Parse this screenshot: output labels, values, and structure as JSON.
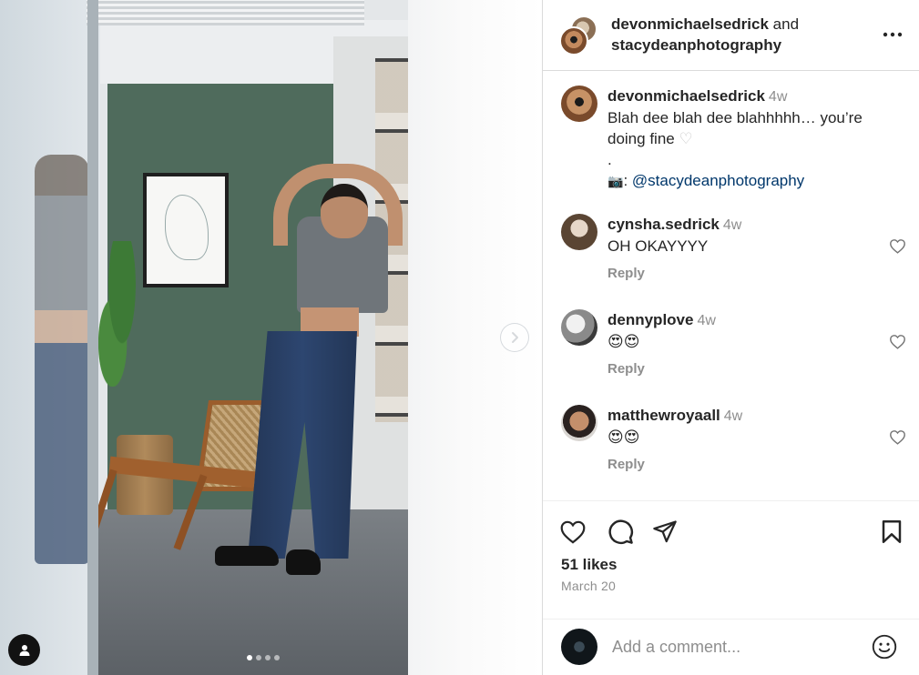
{
  "header": {
    "user1": "devonmichaelsedrick",
    "conjunction": "and",
    "user2": "stacydeanphotography"
  },
  "caption": {
    "username": "devonmichaelsedrick",
    "time": "4w",
    "text": "Blah dee blah dee blahhhhh… you’re doing fine",
    "heart": "♡",
    "dot": ".",
    "camera_emoji": "📷",
    "credit_sep": ":",
    "mention": "@stacydeanphotography"
  },
  "comments": [
    {
      "username": "cynsha.sedrick",
      "time": "4w",
      "text": "OH OKAYYYY",
      "reply": "Reply"
    },
    {
      "username": "dennyplove",
      "time": "4w",
      "text": "😍😍",
      "reply": "Reply"
    },
    {
      "username": "matthewroyaall",
      "time": "4w",
      "text": "😍😍",
      "reply": "Reply"
    }
  ],
  "engagement": {
    "likes": "51 likes",
    "date": "March 20"
  },
  "add_comment": {
    "placeholder": "Add a comment..."
  },
  "carousel": {
    "count": 4,
    "active": 0
  },
  "icons": {
    "more": "more-horizontal-icon",
    "next": "chevron-right-icon",
    "tag": "user-tag-icon",
    "like": "heart-icon",
    "comment": "comment-bubble-icon",
    "share": "paper-plane-icon",
    "save": "bookmark-icon",
    "emoji": "smiley-icon"
  },
  "colors": {
    "text": "#262626",
    "secondary": "#8e8e8e",
    "mention": "#00376b",
    "border": "#dbdbdb"
  }
}
